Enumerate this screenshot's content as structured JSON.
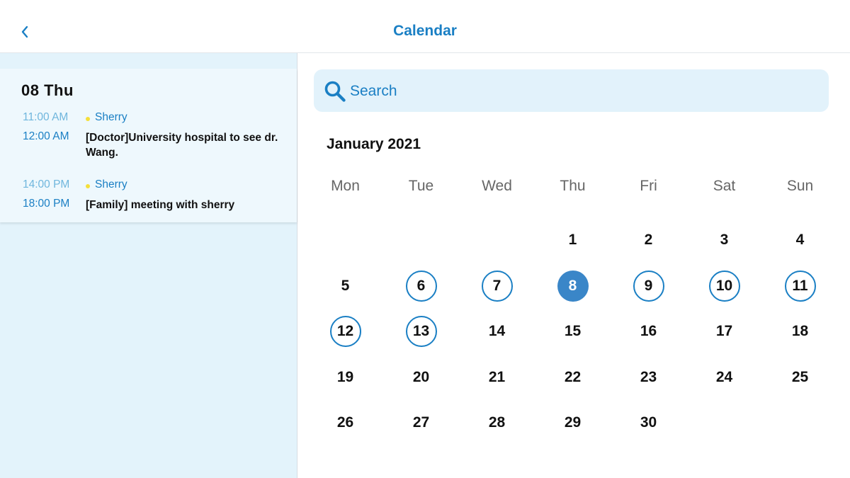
{
  "header": {
    "title": "Calendar"
  },
  "schedule": {
    "day_title": "08 Thu",
    "events": [
      {
        "start": "11:00 AM",
        "end": "12:00 AM",
        "person": "Sherry",
        "description": "[Doctor]University hospital to see dr. Wang."
      },
      {
        "start": "14:00 PM",
        "end": "18:00 PM",
        "person": "Sherry",
        "description": "[Family] meeting with sherry"
      }
    ]
  },
  "search": {
    "placeholder": "Search"
  },
  "calendar": {
    "month_label": "January 2021",
    "weekdays": [
      "Mon",
      "Tue",
      "Wed",
      "Thu",
      "Fri",
      "Sat",
      "Sun"
    ],
    "leading_blank_days": 3,
    "days_in_month": 30,
    "selected_day": 8,
    "marked_days": [
      6,
      7,
      9,
      10,
      11,
      12,
      13
    ]
  },
  "colors": {
    "accent": "#1a7fc4",
    "selected_fill": "#3a86c8",
    "event_dot": "#f5df3a",
    "panel_background": "#e3f3fb"
  }
}
